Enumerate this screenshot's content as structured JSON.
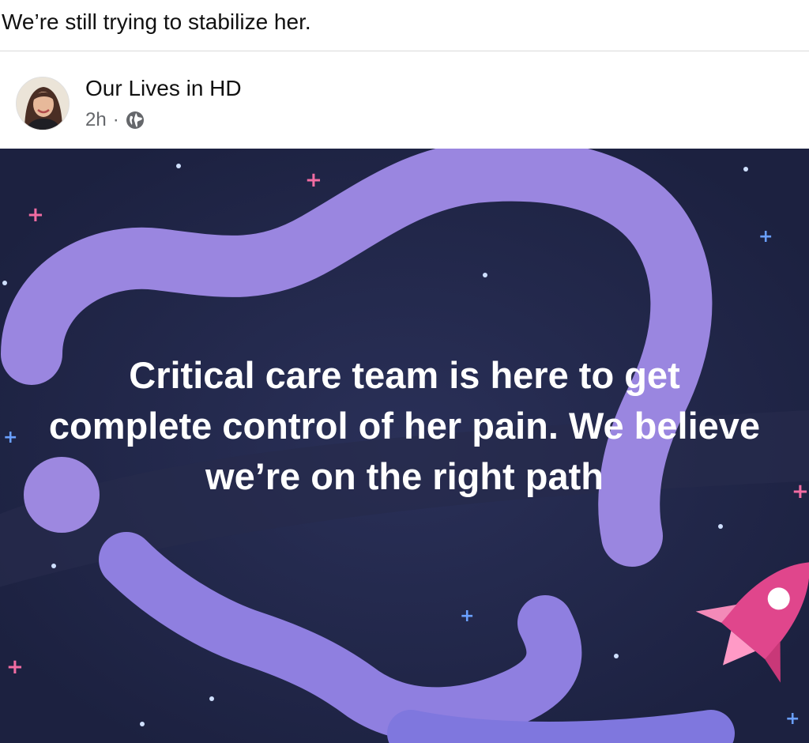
{
  "post": {
    "caption": "We’re still trying to stabilize her.",
    "author": "Our Lives in HD",
    "time": "2h",
    "privacy_icon": "globe-icon",
    "image_text": "Critical care team is here to get complete control of her pain. We believe we’re on the right path"
  },
  "colors": {
    "background_dark": "#1e2340",
    "blob_purple": "#9a86e0",
    "rocket_pink": "#e0468c"
  }
}
